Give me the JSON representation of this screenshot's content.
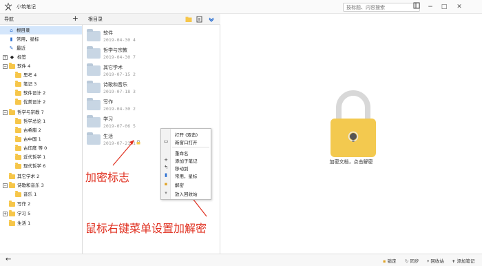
{
  "app": {
    "title": "小筑笔记"
  },
  "search": {
    "placeholder": "按标题、内容搜索"
  },
  "nav": {
    "header": "导航",
    "add": "+",
    "items": [
      {
        "label": "根目录",
        "icon": "home-icon"
      },
      {
        "label": "常用，星标",
        "icon": "bookmark-icon"
      },
      {
        "label": "最近",
        "icon": "edit-icon"
      },
      {
        "label": "标签",
        "icon": "tag-icon"
      },
      {
        "label": "软件 4"
      },
      {
        "label": "思考 4"
      },
      {
        "label": "笔记 3"
      },
      {
        "label": "软件设计 2"
      },
      {
        "label": "优美设计 2"
      },
      {
        "label": "哲学与宗教 7"
      },
      {
        "label": "哲学总论 1"
      },
      {
        "label": "古希腊 2"
      },
      {
        "label": "古中国 1"
      },
      {
        "label": "古印度 等 0"
      },
      {
        "label": "近代哲学 1"
      },
      {
        "label": "现代哲学 6"
      },
      {
        "label": "其它学术 2"
      },
      {
        "label": "诗歌和音乐 3"
      },
      {
        "label": "音乐 1"
      },
      {
        "label": "写作 2"
      },
      {
        "label": "学习 5"
      },
      {
        "label": "生活 1"
      }
    ]
  },
  "list": {
    "header": "根目录",
    "items": [
      {
        "name": "软件",
        "meta": "2019-04-30  4"
      },
      {
        "name": "哲学与宗教",
        "meta": "2019-04-30  7"
      },
      {
        "name": "其它学术",
        "meta": "2019-07-15  2"
      },
      {
        "name": "诗歌和音乐",
        "meta": "2019-07-18  3"
      },
      {
        "name": "写作",
        "meta": "2019-04-30  2"
      },
      {
        "name": "学习",
        "meta": "2019-07-06  5"
      },
      {
        "name": "生活",
        "meta": "2019-07-21  1"
      }
    ]
  },
  "context_menu": {
    "open": "打开 (双击)",
    "open_new": "新窗口打开",
    "rename": "重命名",
    "add_sub": "添加子笔记",
    "move": "移动到",
    "star": "常用，星标",
    "decrypt": "解密",
    "recycle": "放入回收站"
  },
  "annotations": {
    "encrypt_mark": "加密标志",
    "right_click": "鼠标右键菜单设置加解密"
  },
  "pane": {
    "caption": "加密文档，点击解密"
  },
  "bottom": {
    "lock": "锁定",
    "sync": "同步",
    "recycle": "回收站",
    "add_note": "添加笔记"
  },
  "colors": {
    "selection": "#d4e6fb",
    "folder": "#f6c64a",
    "lock_body": "#f3c94f",
    "annotation": "#e03020"
  }
}
